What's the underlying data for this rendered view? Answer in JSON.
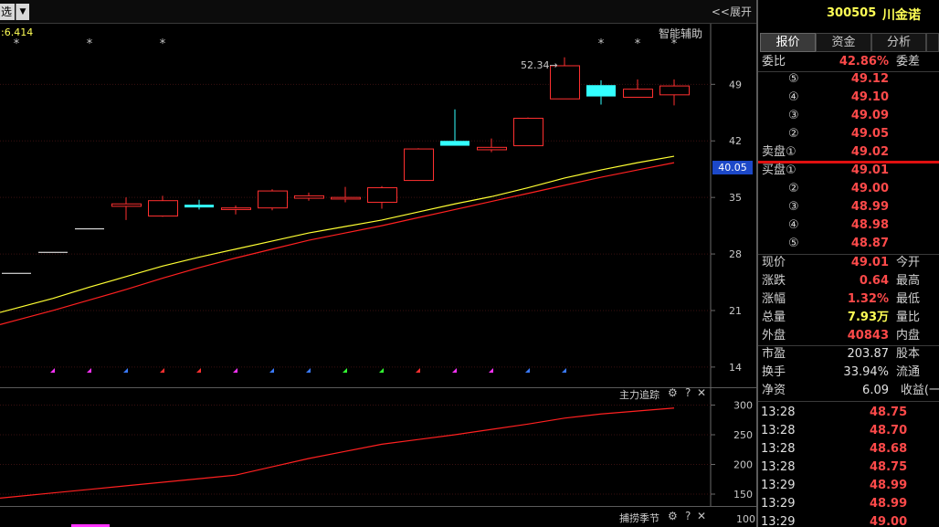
{
  "toolbar": {
    "select_label": "选",
    "expand_label": "<<展开"
  },
  "chart_info": {
    "value_text": ":6.414",
    "assist_label": "智能辅助",
    "max_label": "52.34→",
    "current_price_tag": "40.05"
  },
  "chart_data": [
    {
      "type": "candlestick",
      "y_ticks": [
        49,
        42,
        35,
        28,
        21,
        14
      ],
      "ylim": [
        11.5,
        56.5
      ],
      "candles": [
        {
          "o": 25.6,
          "h": 25.6,
          "l": 25.6,
          "c": 25.6,
          "color": "white"
        },
        {
          "o": 28.2,
          "h": 28.2,
          "l": 28.2,
          "c": 28.2,
          "color": "white"
        },
        {
          "o": 31.1,
          "h": 31.1,
          "l": 31.1,
          "c": 31.1,
          "color": "white"
        },
        {
          "o": 33.9,
          "h": 35.0,
          "l": 32.2,
          "c": 34.2,
          "color": "red"
        },
        {
          "o": 32.7,
          "h": 35.2,
          "l": 32.6,
          "c": 34.6,
          "color": "red"
        },
        {
          "o": 33.9,
          "h": 34.7,
          "l": 33.5,
          "c": 34.1,
          "color": "cyan"
        },
        {
          "o": 33.5,
          "h": 34.0,
          "l": 32.9,
          "c": 33.7,
          "color": "red"
        },
        {
          "o": 33.7,
          "h": 36.0,
          "l": 33.4,
          "c": 35.8,
          "color": "red"
        },
        {
          "o": 34.9,
          "h": 35.6,
          "l": 34.6,
          "c": 35.2,
          "color": "red"
        },
        {
          "o": 34.8,
          "h": 36.3,
          "l": 34.4,
          "c": 35.0,
          "color": "red"
        },
        {
          "o": 34.4,
          "h": 36.4,
          "l": 33.6,
          "c": 36.2,
          "color": "red"
        },
        {
          "o": 37.1,
          "h": 41.1,
          "l": 37.1,
          "c": 41.0,
          "color": "red"
        },
        {
          "o": 42.0,
          "h": 45.9,
          "l": 41.4,
          "c": 41.4,
          "color": "cyan"
        },
        {
          "o": 40.9,
          "h": 42.3,
          "l": 40.6,
          "c": 41.2,
          "color": "red"
        },
        {
          "o": 41.4,
          "h": 44.9,
          "l": 41.4,
          "c": 44.8,
          "color": "red"
        },
        {
          "o": 47.2,
          "h": 52.34,
          "l": 47.2,
          "c": 51.3,
          "color": "red"
        },
        {
          "o": 48.9,
          "h": 49.5,
          "l": 46.5,
          "c": 47.5,
          "color": "cyan"
        },
        {
          "o": 47.4,
          "h": 49.6,
          "l": 47.4,
          "c": 48.4,
          "color": "red"
        },
        {
          "o": 47.7,
          "h": 49.6,
          "l": 46.4,
          "c": 48.8,
          "color": "red"
        }
      ],
      "ma_yellow": [
        21.3,
        22.5,
        23.9,
        25.2,
        26.5,
        27.6,
        28.6,
        29.6,
        30.6,
        31.4,
        32.2,
        33.2,
        34.2,
        35.1,
        36.2,
        37.4,
        38.4,
        39.3,
        40.1
      ],
      "ma_red": [
        19.8,
        21.0,
        22.3,
        23.6,
        25.0,
        26.3,
        27.5,
        28.6,
        29.7,
        30.6,
        31.5,
        32.5,
        33.5,
        34.5,
        35.5,
        36.5,
        37.5,
        38.4,
        39.3
      ],
      "star_candles": [
        0,
        2,
        4,
        16,
        17,
        18
      ],
      "marker_colors": [
        "#ff33ff",
        "#ff33ff",
        "#3a7bff",
        "#ff3030",
        "#ff3030",
        "#ff33ff",
        "#3a7bff",
        "#3a7bff",
        "#33ff33",
        "#33ff33",
        "#ff3030",
        "#ff33ff",
        "#ff33ff",
        "#3a7bff",
        "#3a7bff"
      ]
    },
    {
      "type": "line",
      "title": "主力追踪",
      "y_ticks": [
        300,
        250,
        200,
        150
      ],
      "ylim": [
        130,
        330
      ],
      "values": [
        146,
        152,
        158,
        164,
        170,
        176,
        182,
        196,
        210,
        222,
        234,
        242,
        250,
        259,
        268,
        278,
        285,
        290,
        295
      ]
    },
    {
      "type": "line",
      "title": "捕捞季节",
      "y_ticks": [
        100
      ],
      "values": []
    }
  ],
  "panel": {
    "stock_code": "300505",
    "stock_name": "川金诺",
    "tabs": [
      "报价",
      "资金",
      "分析"
    ],
    "weibi": {
      "label": "委比",
      "value": "42.86%",
      "label2": "委差"
    },
    "sell_orders": [
      {
        "num": "⑤",
        "price": "49.12"
      },
      {
        "num": "④",
        "price": "49.10"
      },
      {
        "num": "③",
        "price": "49.09"
      },
      {
        "num": "②",
        "price": "49.05"
      },
      {
        "num": "卖盘①",
        "price": "49.02"
      }
    ],
    "buy_orders": [
      {
        "num": "买盘①",
        "price": "49.01"
      },
      {
        "num": "②",
        "price": "49.00"
      },
      {
        "num": "③",
        "price": "48.99"
      },
      {
        "num": "④",
        "price": "48.98"
      },
      {
        "num": "⑤",
        "price": "48.87"
      }
    ],
    "quote_rows": [
      {
        "label": "现价",
        "value": "49.01",
        "label2": "今开",
        "color": "#ff4a4a"
      },
      {
        "label": "涨跌",
        "value": "0.64",
        "label2": "最高",
        "color": "#ff4a4a"
      },
      {
        "label": "涨幅",
        "value": "1.32%",
        "label2": "最低",
        "color": "#ff4a4a"
      },
      {
        "label": "总量",
        "value": "7.93万",
        "label2": "量比",
        "color": "#ffff55"
      },
      {
        "label": "外盘",
        "value": "40843",
        "label2": "内盘",
        "color": "#ff4a4a"
      }
    ],
    "fund_rows": [
      {
        "label": "市盈",
        "value": "203.87",
        "label2": "股本"
      },
      {
        "label": "换手",
        "value": "33.94%",
        "label2": "流通"
      },
      {
        "label": "净资",
        "value": "6.09",
        "label2": "收益(一"
      }
    ],
    "trades": [
      {
        "time": "13:28",
        "price": "48.75"
      },
      {
        "time": "13:28",
        "price": "48.70"
      },
      {
        "time": "13:28",
        "price": "48.68"
      },
      {
        "time": "13:28",
        "price": "48.75"
      },
      {
        "time": "13:29",
        "price": "48.99"
      },
      {
        "time": "13:29",
        "price": "48.99"
      },
      {
        "time": "13:29",
        "price": "49.00"
      }
    ]
  },
  "colors": {
    "up": "#ff3030",
    "down_cyan": "#33ffff",
    "ma_yellow": "#ffff33",
    "ma_red": "#ff2020",
    "price_tag_bg": "#1c48c8"
  }
}
